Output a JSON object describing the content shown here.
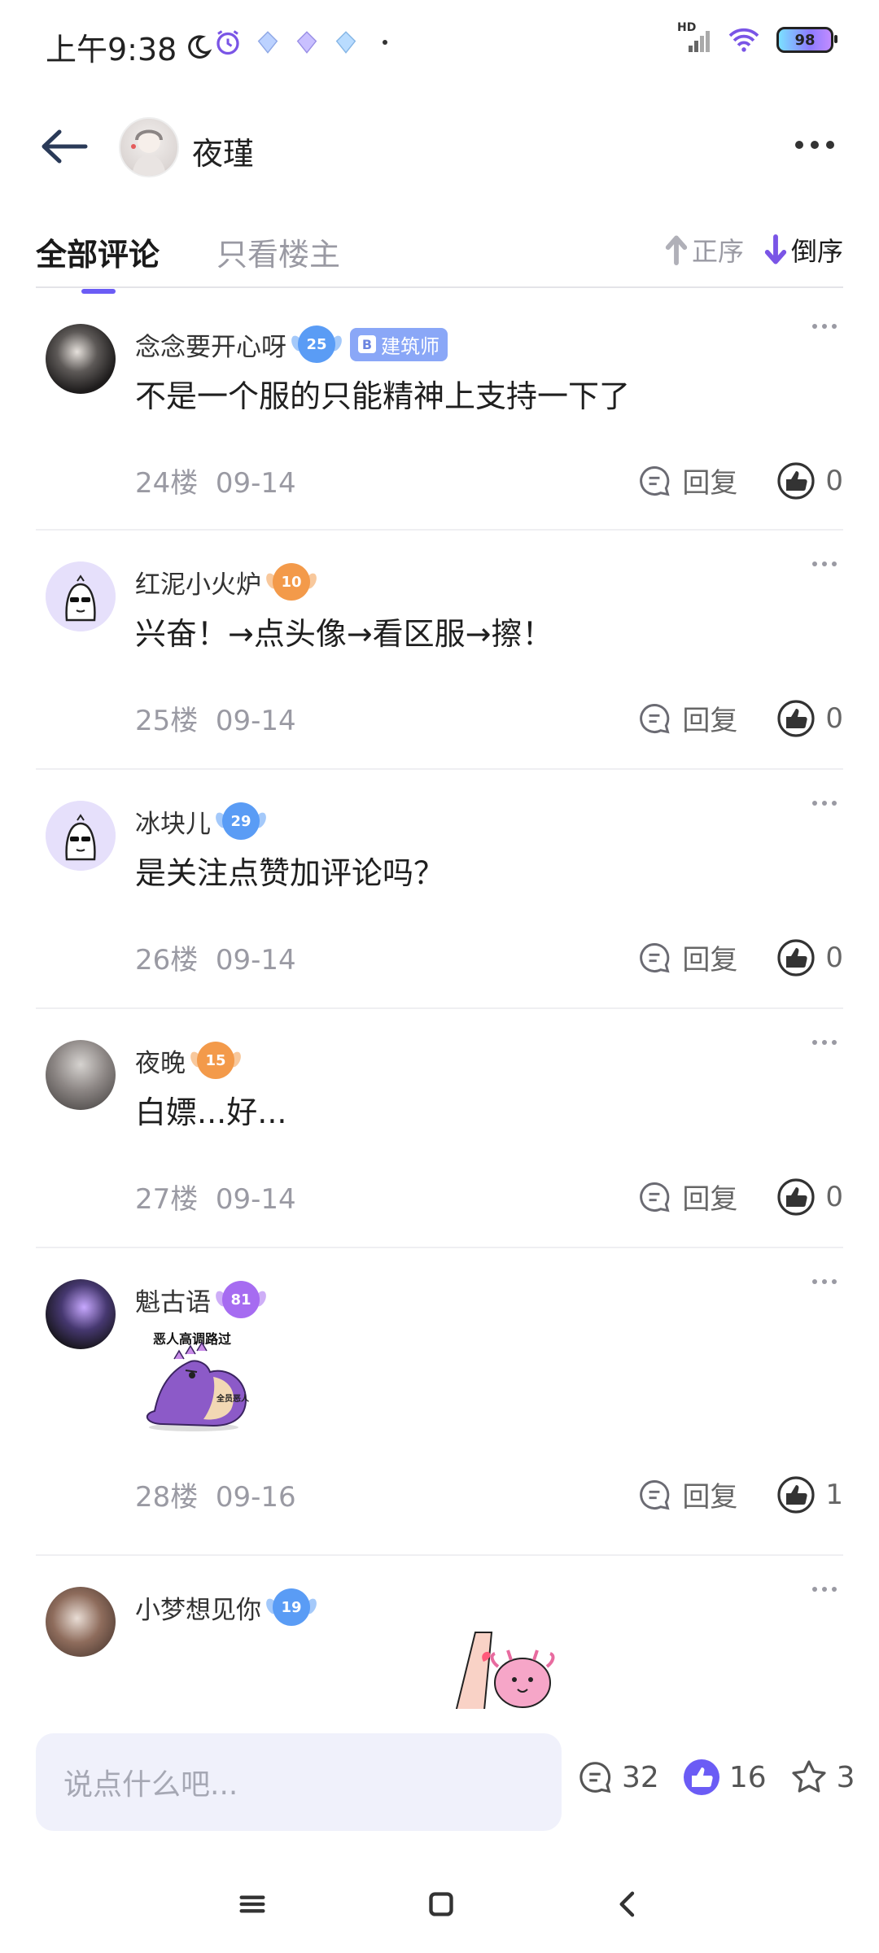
{
  "status_bar": {
    "time": "上午9:38",
    "network": "HD",
    "battery": "98"
  },
  "header": {
    "author_name": "夜瑾"
  },
  "tabs": {
    "all": "全部评论",
    "op_only": "只看楼主",
    "sort_asc": "正序",
    "sort_desc": "倒序"
  },
  "actions": {
    "reply_label": "回复"
  },
  "comments": [
    {
      "user": "念念要开心呀",
      "level": "25",
      "badge": "建筑师",
      "text": "不是一个服的只能精神上支持一下了",
      "floor": "24楼",
      "date": "09-14",
      "likes": "0"
    },
    {
      "user": "红泥小火炉",
      "level": "10",
      "text": "兴奋！→点头像→看区服→擦！",
      "floor": "25楼",
      "date": "09-14",
      "likes": "0"
    },
    {
      "user": "冰块儿",
      "level": "29",
      "text": "是关注点赞加评论吗？",
      "floor": "26楼",
      "date": "09-14",
      "likes": "0"
    },
    {
      "user": "夜晚",
      "level": "15",
      "text": "白嫖...好...",
      "floor": "27楼",
      "date": "09-14",
      "likes": "0"
    },
    {
      "user": "魁古语",
      "level": "81",
      "sticker_caption": "恶人高调路过",
      "sticker_tag": "全员恶人",
      "floor": "28楼",
      "date": "09-16",
      "likes": "1"
    },
    {
      "user": "小梦想见你",
      "level": "19"
    }
  ],
  "bottom_bar": {
    "input_placeholder": "说点什么吧...",
    "comment_count": "32",
    "like_count": "16",
    "star_count": "3"
  },
  "colors": {
    "accent": "#6b5cf5",
    "muted_text": "#9a9aa3",
    "input_bg": "#f0f1fb"
  }
}
